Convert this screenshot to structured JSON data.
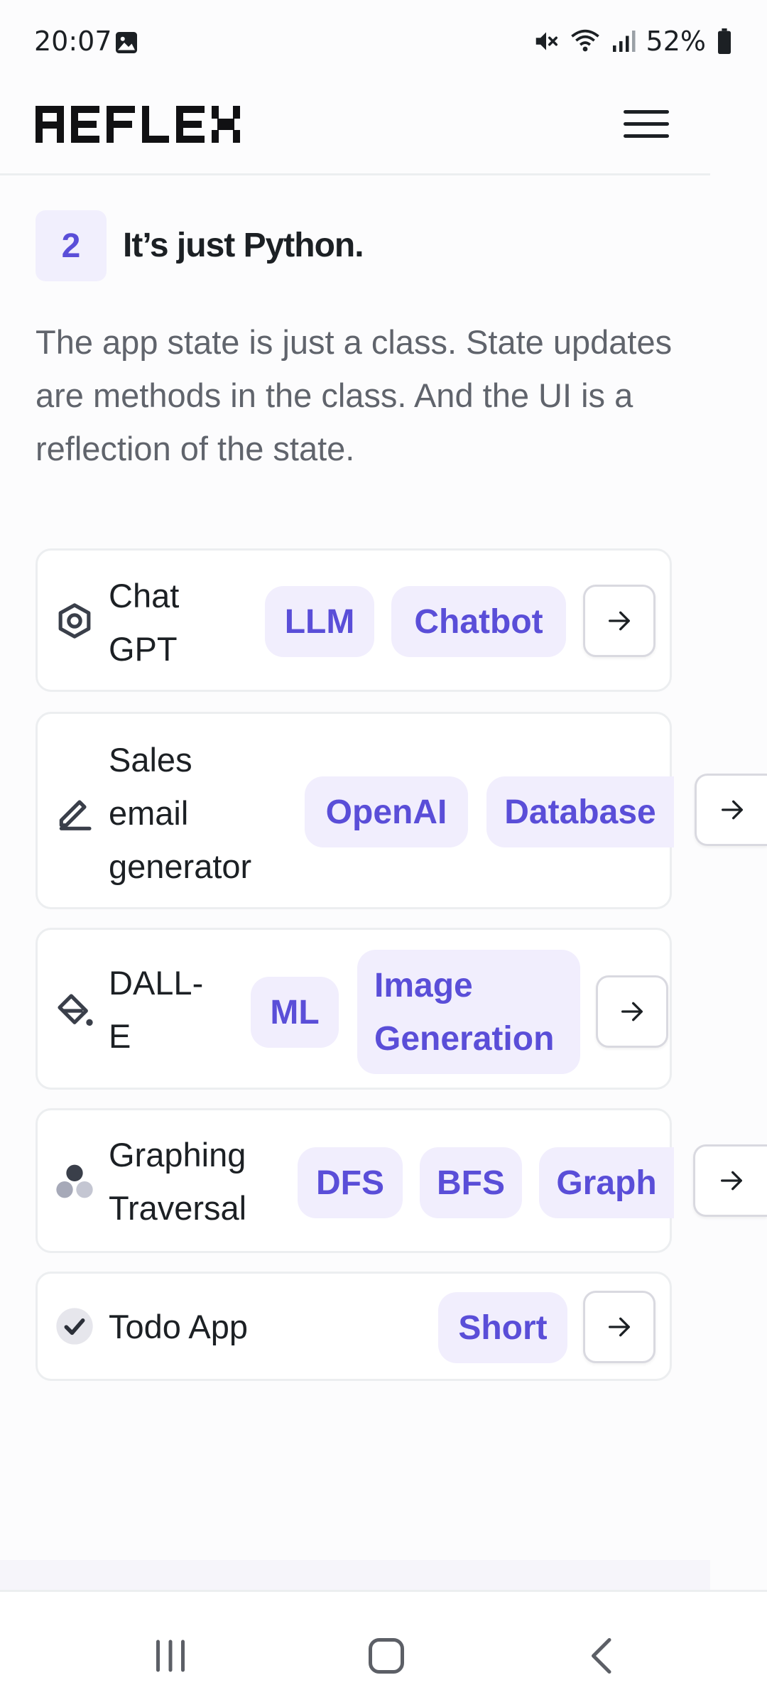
{
  "status_bar": {
    "time": "20:07",
    "battery": "52%"
  },
  "header": {
    "logo_text": "REFLEX"
  },
  "section": {
    "step_number": "2",
    "title": "It’s just Python.",
    "description": "The app state is just a class. State updates are methods in the class. And the UI is a reflection of the state."
  },
  "examples": [
    {
      "title_lines": [
        "Chat",
        "GPT"
      ],
      "icon": "hexagon-icon",
      "tags": [
        "LLM",
        "Chatbot"
      ]
    },
    {
      "title_lines": [
        "Sales",
        "email",
        "generator"
      ],
      "icon": "pencil-icon",
      "tags": [
        "OpenAI",
        "Database"
      ]
    },
    {
      "title_lines": [
        "DALL-",
        "E"
      ],
      "icon": "paint-bucket-icon",
      "tags": [
        "ML",
        "Image",
        "Generation"
      ]
    },
    {
      "title_lines": [
        "Graphing",
        "Traversal"
      ],
      "icon": "graph-dots-icon",
      "tags": [
        "DFS",
        "BFS",
        "Graph"
      ]
    },
    {
      "title_lines": [
        "Todo App"
      ],
      "icon": "check-circle-icon",
      "tags": [
        "Short"
      ]
    }
  ],
  "colors": {
    "accent": "#5a4ed8",
    "tag_bg": "#f1eefd",
    "text": "#1c2024",
    "muted": "#60646c"
  }
}
